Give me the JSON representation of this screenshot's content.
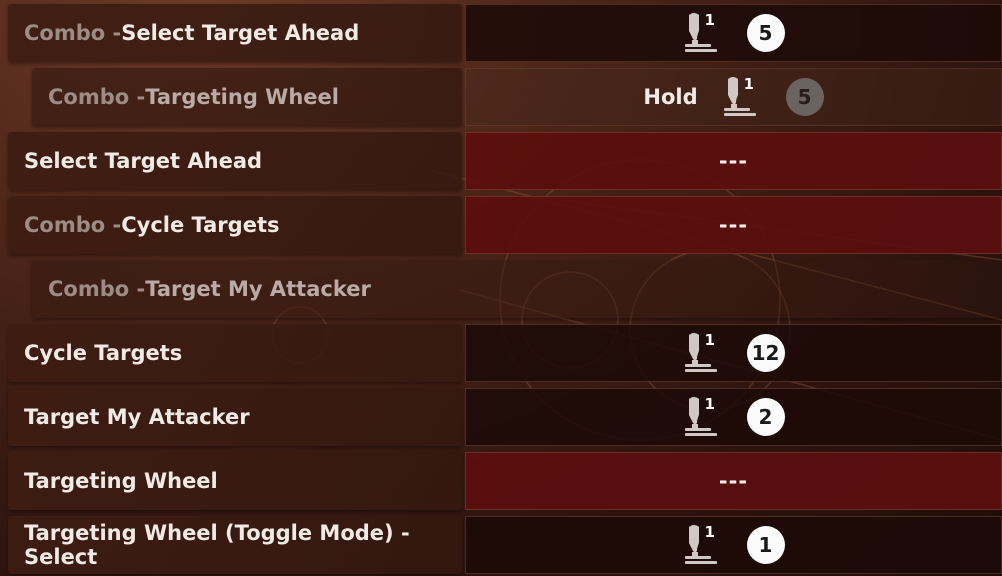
{
  "colors": {
    "badge_bg": "#fbfbfb",
    "empty_binding_bg": "#5c0e0e",
    "prefix_text": "#9b8c85"
  },
  "rows": [
    {
      "prefix": "Combo - ",
      "label": "Select Target Ahead",
      "sub": false,
      "binding": {
        "hold": "",
        "device_icon": "joystick-icon",
        "device_num": "1",
        "button": "5",
        "empty": ""
      }
    },
    {
      "prefix": "Combo - ",
      "label": "Targeting Wheel",
      "sub": true,
      "binding": {
        "hold": "Hold",
        "device_icon": "joystick-icon",
        "device_num": "1",
        "button": "5",
        "empty": ""
      }
    },
    {
      "prefix": "",
      "label": "Select Target Ahead",
      "sub": false,
      "binding": {
        "empty": "---"
      }
    },
    {
      "prefix": "Combo - ",
      "label": "Cycle Targets",
      "sub": false,
      "binding": {
        "empty": "---"
      }
    },
    {
      "prefix": "Combo - ",
      "label": "Target My Attacker",
      "sub": true,
      "binding": null
    },
    {
      "prefix": "",
      "label": "Cycle Targets",
      "sub": false,
      "binding": {
        "hold": "",
        "device_icon": "joystick-icon",
        "device_num": "1",
        "button": "12",
        "empty": ""
      }
    },
    {
      "prefix": "",
      "label": "Target My Attacker",
      "sub": false,
      "binding": {
        "hold": "",
        "device_icon": "joystick-icon",
        "device_num": "1",
        "button": "2",
        "empty": ""
      }
    },
    {
      "prefix": "",
      "label": "Targeting Wheel",
      "sub": false,
      "binding": {
        "empty": "---"
      }
    },
    {
      "prefix": "",
      "label": "Targeting Wheel (Toggle Mode) - Select",
      "sub": false,
      "binding": {
        "hold": "",
        "device_icon": "joystick-icon",
        "device_num": "1",
        "button": "1",
        "empty": ""
      }
    }
  ]
}
